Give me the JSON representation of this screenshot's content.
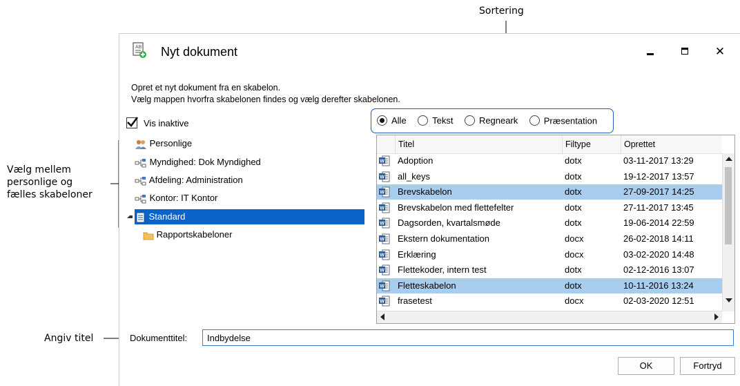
{
  "annotations": {
    "sorting": "Sortering",
    "choose": [
      "Vælg mellem",
      "personlige og",
      "fælles skabeloner"
    ],
    "title": "Angiv titel"
  },
  "window": {
    "title": "Nyt dokument",
    "description_lines": [
      "Opret et nyt dokument fra en skabelon.",
      "Vælg mappen hvorfra skabelonen findes og vælg derefter skabelonen."
    ]
  },
  "show_inactive": {
    "label": "Vis inaktive",
    "checked": true
  },
  "tree": {
    "items": [
      {
        "label": "Personlige",
        "icon": "users-icon"
      },
      {
        "label": "Myndighed: Dok Myndighed",
        "icon": "network-icon"
      },
      {
        "label": "Afdeling: Administration",
        "icon": "network-icon"
      },
      {
        "label": "Kontor: IT Kontor",
        "icon": "network-icon"
      },
      {
        "label": "Standard",
        "icon": "document-icon",
        "selected": true,
        "expanded": true
      },
      {
        "label": "Rapportskabeloner",
        "icon": "folder-icon"
      }
    ]
  },
  "filter": {
    "options": [
      "Alle",
      "Tekst",
      "Regneark",
      "Præsentation"
    ],
    "selected": "Alle"
  },
  "grid": {
    "columns": [
      "Titel",
      "Filtype",
      "Oprettet"
    ],
    "rows": [
      {
        "title": "Adoption",
        "type": "dotx",
        "created": "03-11-2017 13:29"
      },
      {
        "title": "all_keys",
        "type": "dotx",
        "created": "19-12-2017 13:57"
      },
      {
        "title": "Brevskabelon",
        "type": "dotx",
        "created": "27-09-2017 14:25",
        "highlight": true
      },
      {
        "title": "Brevskabelon med flettefelter",
        "type": "dotx",
        "created": "27-11-2017 13:45"
      },
      {
        "title": "Dagsorden, kvartalsmøde",
        "type": "dotx",
        "created": "19-06-2014 22:59"
      },
      {
        "title": "Ekstern dokumentation",
        "type": "docx",
        "created": "26-02-2018 14:11"
      },
      {
        "title": "Erklæring",
        "type": "docx",
        "created": "03-02-2020 14:48"
      },
      {
        "title": "Flettekoder, intern test",
        "type": "dotx",
        "created": "02-12-2016 13:07"
      },
      {
        "title": "Fletteskabelon",
        "type": "dotx",
        "created": "10-11-2016 13:24",
        "highlight": true
      },
      {
        "title": "frasetest",
        "type": "docx",
        "created": "02-03-2020 12:51"
      }
    ]
  },
  "doc_title": {
    "label": "Dokumenttitel:",
    "value": "Indbydelse"
  },
  "buttons": {
    "ok": "OK",
    "cancel": "Fortryd"
  },
  "colors": {
    "selection": "#0a63c9",
    "highlight": "#a9cdee",
    "frame": "#1f5fbf"
  }
}
